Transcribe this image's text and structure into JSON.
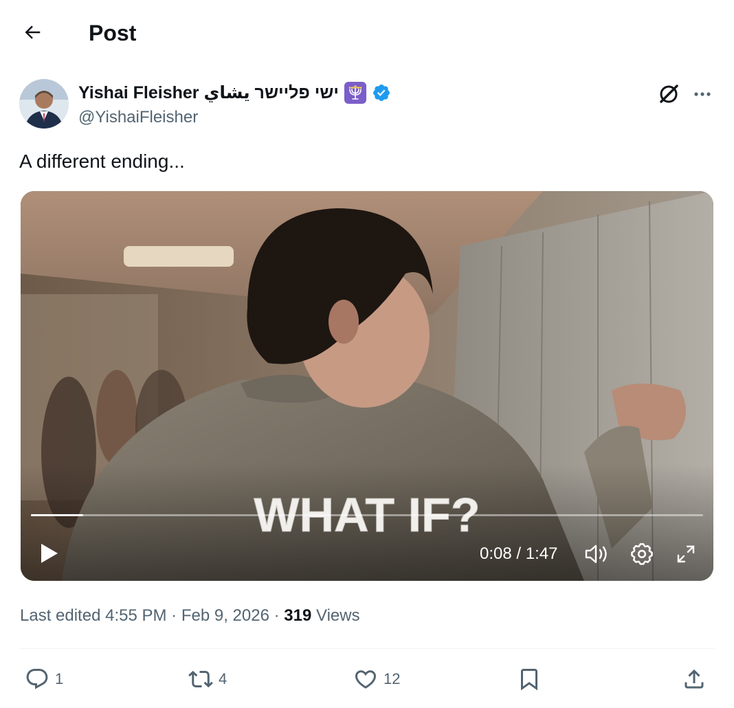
{
  "header": {
    "title": "Post",
    "back_icon": "arrow-left-icon"
  },
  "author": {
    "display_name": "Yishai Fleisher ישי פליישר يشاي",
    "handle": "@YishaiFleisher",
    "badge_icon": "menorah-icon",
    "verified_icon": "verified-badge-icon",
    "verified_color": "#1d9bf0"
  },
  "post": {
    "text": "A different ending..."
  },
  "video": {
    "caption": "WHAT IF?",
    "current_time": "0:08",
    "separator": "/",
    "duration": "1:47",
    "progress_fraction": 0.078,
    "icons": [
      "play-icon",
      "volume-icon",
      "settings-gear-icon",
      "fullscreen-icon"
    ]
  },
  "meta": {
    "edited_label": "Last edited",
    "time": "4:55 PM",
    "dot": "·",
    "date": "Feb 9, 2026",
    "views_count": "319",
    "views_label": "Views"
  },
  "actions": {
    "replies": "1",
    "reposts": "4",
    "likes": "12"
  },
  "colors": {
    "text_primary": "#0f1419",
    "text_secondary": "#536471",
    "accent": "#1d9bf0",
    "badge_purple": "#7b5ec9"
  }
}
